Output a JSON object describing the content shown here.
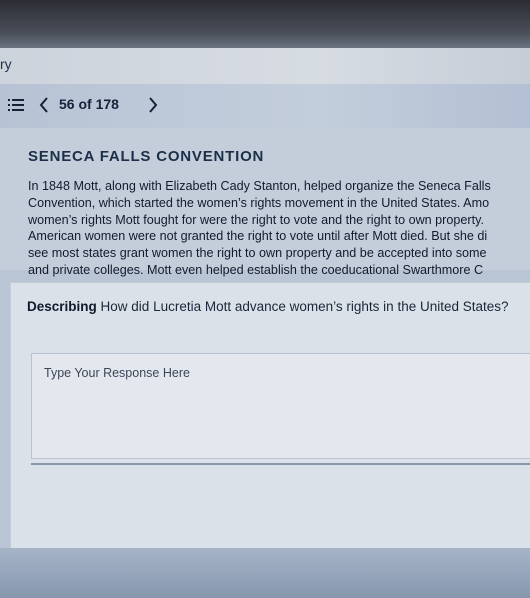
{
  "app": {
    "title": "ry"
  },
  "nav": {
    "page_indicator": "56 of 178",
    "menu_icon": "menu-list-icon",
    "prev_icon": "chevron-left-icon",
    "next_icon": "chevron-right-icon"
  },
  "reading": {
    "section_title": "SENECA FALLS CONVENTION",
    "passage_lines": [
      "In 1848 Mott, along with Elizabeth Cady Stanton, helped organize the Seneca Falls",
      "Convention, which started the women’s rights movement in the United States. Amo",
      "women’s rights Mott fought for were the right to vote and the right to own property.",
      "American women were not granted the right to vote until after Mott died. But she di",
      "see most states grant women the right to own property and be accepted into some",
      "and private colleges. Mott even helped establish the coeducational Swarthmore C"
    ]
  },
  "question": {
    "label": "Describing",
    "text": "How did Lucretia Mott advance women’s rights in the United States?",
    "response_placeholder": "Type Your Response Here",
    "response_value": ""
  },
  "colors": {
    "background": "#b9c4d4",
    "nav_text": "#13233a",
    "card": "#dbe1e8"
  }
}
